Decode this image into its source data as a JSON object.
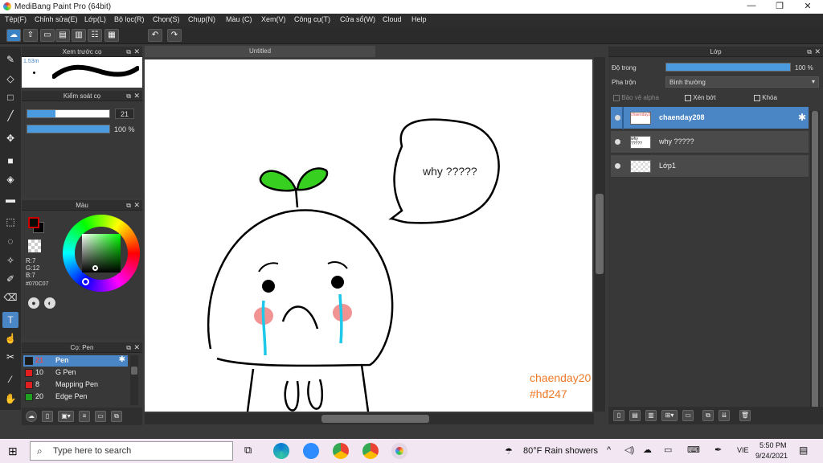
{
  "window": {
    "title": "MediBang Paint Pro (64bit)",
    "min": "—",
    "max": "❐",
    "close": "✕"
  },
  "menu": [
    "Tệp(F)",
    "Chỉnh sửa(E)",
    "Lớp(L)",
    "Bộ lọc(R)",
    "Chọn(S)",
    "Chụp(N)",
    "Màu (C)",
    "Xem(V)",
    "Công cụ(T)",
    "Cửa sổ(W)",
    "Cloud",
    "Help"
  ],
  "toolbar": {
    "undo": "↶",
    "redo": "↷"
  },
  "brush_preview": {
    "title": "Xem trước cọ",
    "size_label": "1.53m"
  },
  "brush_control": {
    "title": "Kiểm soát cọ",
    "size_value": "21",
    "size_fill": 0.34,
    "opacity_value": "100 %",
    "opacity_fill": 1.0
  },
  "color_panel": {
    "title": "Màu",
    "r": "R:7",
    "g": "G:12",
    "b": "B:7",
    "hex": "#070C07"
  },
  "brush_panel": {
    "title": "Cọ: Pen",
    "items": [
      {
        "size": "21",
        "name": "Pen",
        "color": "#1a1a1a",
        "selected": true
      },
      {
        "size": "10",
        "name": "G Pen",
        "color": "#e02020",
        "selected": false
      },
      {
        "size": "8",
        "name": "Mapping Pen",
        "color": "#e02020",
        "selected": false
      },
      {
        "size": "20",
        "name": "Edge Pen",
        "color": "#20a020",
        "selected": false
      }
    ]
  },
  "canvas": {
    "tab": "Untitled",
    "speech": "why ?????",
    "sig1": "chaenday20",
    "sig2": "#hđ247"
  },
  "layers_panel": {
    "title": "Lớp",
    "opacity_label": "Độ trong",
    "opacity_value": "100 %",
    "blend_label": "Pha trộn",
    "blend_value": "Bình thường",
    "protect_alpha": "Bảo vệ alpha",
    "clip": "Xén bớt",
    "lock": "Khóa",
    "layers": [
      {
        "name": "chaenday208",
        "thumb": "chaenday208",
        "active": true
      },
      {
        "name": "why ?????",
        "thumb": "why ?????",
        "active": false
      },
      {
        "name": "Lớp1",
        "thumb": "",
        "active": false
      }
    ]
  },
  "taskbar": {
    "search_placeholder": "Type here to search",
    "weather": "80°F  Rain showers",
    "lang": "VIE",
    "time": "5:50 PM",
    "date": "9/24/2021"
  },
  "colors": {
    "accent": "#4a86c5",
    "face_tear": "#1ec8e8",
    "blush": "#f08080",
    "sprout": "#38d020"
  }
}
